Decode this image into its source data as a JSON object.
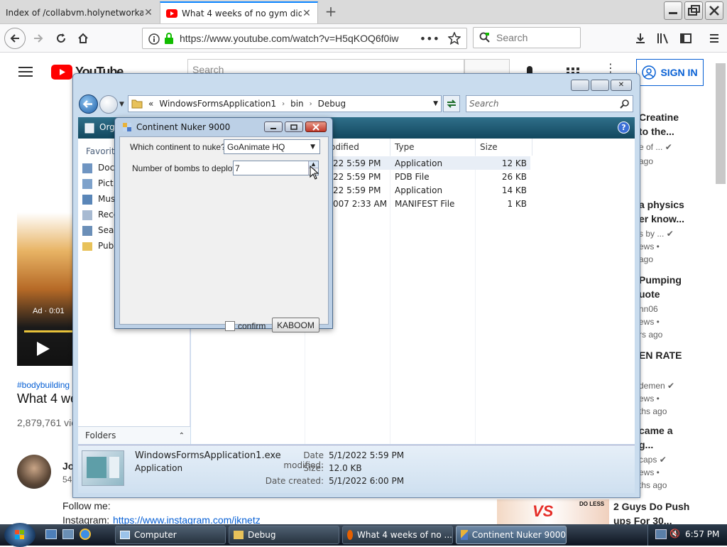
{
  "browser": {
    "tabs": [
      {
        "label": "Index of /collabvm.holynetworkadapt",
        "active": false
      },
      {
        "label": "What 4 weeks of no gym did to",
        "active": true
      }
    ],
    "url": "https://www.youtube.com/watch?v=H5qKOQ6f0iw",
    "search_placeholder": "Search"
  },
  "youtube": {
    "logo_text": "YouTube",
    "search_placeholder": "Search",
    "sign_in": "SIGN IN",
    "ad_label": "Ad · 0:01",
    "hashtag": "#bodybuilding",
    "video_title": "What 4 we",
    "views": "2,879,761 vie",
    "channel_initial": "Jo",
    "channel_subs": "54",
    "desc_follow": "Follow me:",
    "desc_instagram_label": "Instagram:",
    "desc_instagram_link": "https://www.instagram.com/jknetz",
    "sidebar": [
      {
        "title1": "Creatine",
        "title2": "to the...",
        "meta1": "e of ...",
        "meta2": "ago",
        "verified": true
      },
      {
        "title1": "a physics",
        "title2": "er know...",
        "meta1": "s by ...",
        "meta2": "ews •",
        "meta3": "ago",
        "verified": true
      },
      {
        "title1": "Pumping",
        "title2": "uote",
        "meta1": "nn06",
        "meta2": "ews •",
        "meta3": "rs ago",
        "verified": false
      },
      {
        "title1": "EN RATE",
        "meta1": "demen",
        "meta2": "ews •",
        "meta3": "ths ago",
        "verified": true
      },
      {
        "title1": "came a",
        "title2": "g...",
        "meta1": "caps",
        "meta2": "ews •",
        "meta3": "ths ago",
        "verified": true
      },
      {
        "title1": "2 Guys Do Push",
        "title2": "ups For 30...",
        "thumb_text": "VS",
        "thumb_badge": "DO LESS"
      }
    ]
  },
  "explorer": {
    "breadcrumb": [
      "WindowsFormsApplication1",
      "bin",
      "Debug"
    ],
    "breadcrumb_prefix": "«",
    "search_placeholder": "Search",
    "toolbar_organize": "Org",
    "favorites_label": "Favorite",
    "nav_items": [
      "Doc",
      "Pict",
      "Mus",
      "Rece",
      "Sear",
      "Pub"
    ],
    "folders_label": "Folders",
    "columns": {
      "modified": "odified",
      "type": "Type",
      "size": "Size"
    },
    "rows": [
      {
        "date": "22 5:59 PM",
        "type": "Application",
        "size": "12 KB"
      },
      {
        "date": "22 5:59 PM",
        "type": "PDB File",
        "size": "26 KB"
      },
      {
        "date": "22 5:59 PM",
        "type": "Application",
        "size": "14 KB"
      },
      {
        "date": "007 2:33 AM",
        "type": "MANIFEST File",
        "size": "1 KB"
      }
    ],
    "details": {
      "file_name": "WindowsFormsApplication1.exe",
      "file_type": "Application",
      "date_modified_label": "Date modified:",
      "date_modified": "5/1/2022 5:59 PM",
      "size_label": "Size:",
      "size": "12.0 KB",
      "date_created_label": "Date created:",
      "date_created": "5/1/2022 6:00 PM"
    }
  },
  "dialog": {
    "title": "Continent Nuker 9000",
    "continent_label": "Which continent to nuke?",
    "continent_value": "GoAnimate HQ",
    "bombs_label": "Number of bombs to deploy:",
    "bombs_value": "7",
    "confirm_label": "confirm",
    "confirm_checked": false,
    "kaboom_label": "KABOOM"
  },
  "taskbar": {
    "items": [
      {
        "label": "Computer",
        "active": false
      },
      {
        "label": "Debug",
        "active": false
      },
      {
        "label": "What 4 weeks of no ...",
        "active": false
      },
      {
        "label": "Continent Nuker 9000",
        "active": true
      }
    ],
    "clock": "6:57 PM"
  },
  "colors": {
    "firefox_accent": "#0a84ff",
    "youtube_red": "#ff0000",
    "youtube_blue": "#065fd4",
    "aero_blue": "#bcd0e6"
  }
}
